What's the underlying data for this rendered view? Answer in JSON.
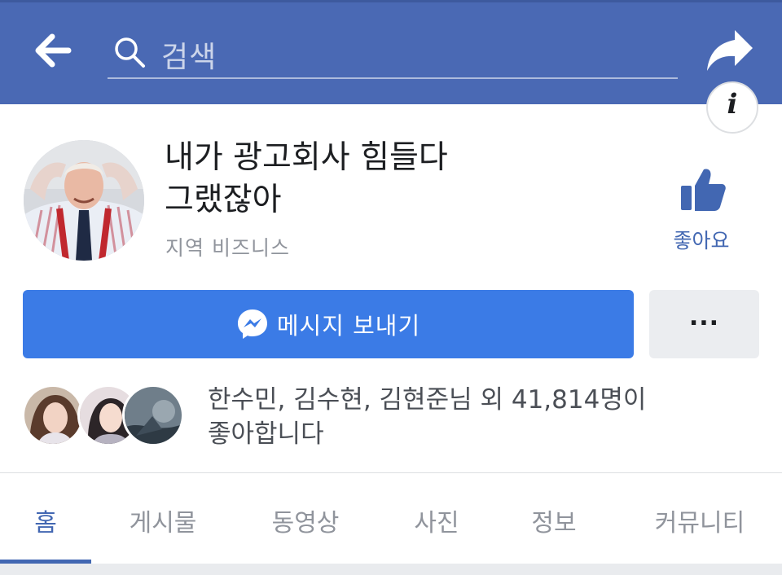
{
  "header": {
    "search_placeholder": "검색",
    "accent_color": "#4a69b4"
  },
  "page": {
    "title_line1": "내가 광고회사 힘들다",
    "title_line2": "그랬잖아",
    "category": "지역 비즈니스",
    "like_label": "좋아요"
  },
  "actions": {
    "message_label": "메시지 보내기",
    "more_label": "...",
    "primary_color": "#3b7be6"
  },
  "social": {
    "likes_line1": "한수민, 김수현, 김현준님 외 41,814명이",
    "likes_line2": "좋아합니다"
  },
  "tabs": [
    {
      "label": "홈",
      "active": true
    },
    {
      "label": "게시물",
      "active": false
    },
    {
      "label": "동영상",
      "active": false
    },
    {
      "label": "사진",
      "active": false
    },
    {
      "label": "정보",
      "active": false
    },
    {
      "label": "커뮤니티",
      "active": false
    }
  ],
  "icons": {
    "back": "arrow-left-icon",
    "search": "search-icon",
    "share": "share-arrow-icon",
    "info": "info-icon",
    "like": "thumbs-up-icon",
    "messenger": "messenger-icon"
  }
}
